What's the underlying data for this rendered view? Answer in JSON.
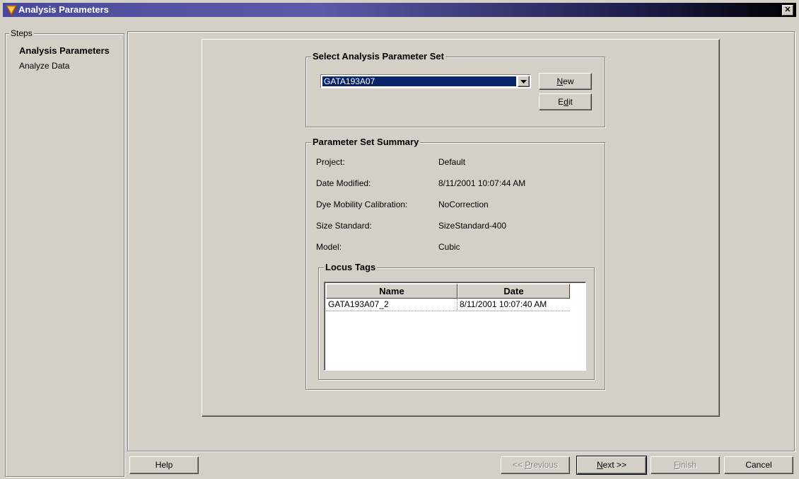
{
  "window": {
    "title": "Analysis Parameters",
    "close_glyph": "✕"
  },
  "steps": {
    "legend": "Steps",
    "items": [
      {
        "label": "Analysis Parameters",
        "current": true
      },
      {
        "label": "Analyze Data",
        "current": false
      }
    ]
  },
  "select_set": {
    "legend": "Select Analysis Parameter Set",
    "selected": "GATA193A07",
    "new_button": {
      "accel": "N",
      "rest": "ew"
    },
    "edit_button": {
      "pre": "E",
      "accel": "d",
      "rest": "it"
    }
  },
  "summary": {
    "legend": "Parameter Set Summary",
    "rows": [
      {
        "label": "Project:",
        "value": "Default"
      },
      {
        "label": "Date Modified:",
        "value": "8/11/2001 10:07:44 AM"
      },
      {
        "label": "Dye Mobility Calibration:",
        "value": "NoCorrection"
      },
      {
        "label": "Size Standard:",
        "value": "SizeStandard-400"
      },
      {
        "label": "Model:",
        "value": "Cubic"
      }
    ]
  },
  "locus_tags": {
    "legend": "Locus Tags",
    "columns": [
      "Name",
      "Date"
    ],
    "rows": [
      {
        "name": "GATA193A07_2",
        "date": "8/11/2001 10:07:40 AM"
      }
    ]
  },
  "footer": {
    "help": "Help",
    "previous": {
      "pre": "<< ",
      "accel": "P",
      "rest": "revious"
    },
    "next": {
      "accel": "N",
      "rest": "ext >>"
    },
    "finish": {
      "accel": "F",
      "rest": "inish"
    },
    "cancel": "Cancel"
  },
  "colors": {
    "titlebar_start": "#4b4a9a",
    "selection": "#0a246a"
  }
}
